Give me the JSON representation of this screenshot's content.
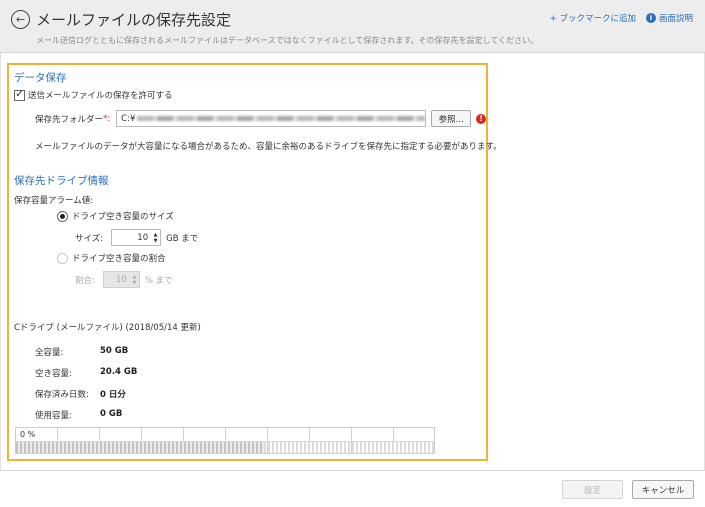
{
  "header": {
    "title": "メールファイルの保存先設定",
    "description": "メール送信ログとともに保存されるメールファイルはデータベースではなくファイルとして保存されます。その保存先を設定してください。",
    "bookmark_link": "+ ブックマークに追加",
    "help_link": "画面説明",
    "help_icon_glyph": "i"
  },
  "data_save": {
    "section_title": "データ保存",
    "allow_checkbox_label": "送信メールファイルの保存を許可する",
    "allow_checked": true,
    "folder_label": "保存先フォルダー",
    "required_mark": "*:",
    "folder_value_prefix": "C:¥",
    "browse_button": "参照...",
    "error_glyph": "!",
    "note": "メールファイルのデータが大容量になる場合があるため、容量に余裕のあるドライブを保存先に指定する必要があります。"
  },
  "drive_info": {
    "section_title": "保存先ドライブ情報",
    "alarm_label": "保存容量アラーム値:",
    "option_size_label": "ドライブ空き容量のサイズ",
    "option_size_selected": true,
    "size_label": "サイズ:",
    "size_value": "10",
    "size_unit": "GB まで",
    "option_ratio_label": "ドライブ空き容量の割合",
    "option_ratio_selected": false,
    "ratio_label": "割合:",
    "ratio_value": "10",
    "ratio_unit": "% まで",
    "drive_caption": "Cドライブ (メールファイル) (2018/05/14 更新)",
    "stats": [
      {
        "label": "全容量:",
        "value": "50 GB"
      },
      {
        "label": "空き容量:",
        "value": "20.4 GB"
      },
      {
        "label": "保存済み日数:",
        "value": "0 日分"
      },
      {
        "label": "使用容量:",
        "value": "0 GB"
      }
    ],
    "usage_bar_label": "0 %",
    "usage_fraction": 0
  },
  "footer": {
    "apply_button": "設定",
    "cancel_button": "キャンセル"
  },
  "colors": {
    "accent": "#2a6ebb",
    "panel_border": "#f2b233",
    "error": "#d9281f"
  },
  "icons": {
    "back": "back-arrow-circle-icon",
    "help": "info-icon",
    "error": "error-exclamation-icon",
    "spin": "spinner-arrows-icon"
  }
}
